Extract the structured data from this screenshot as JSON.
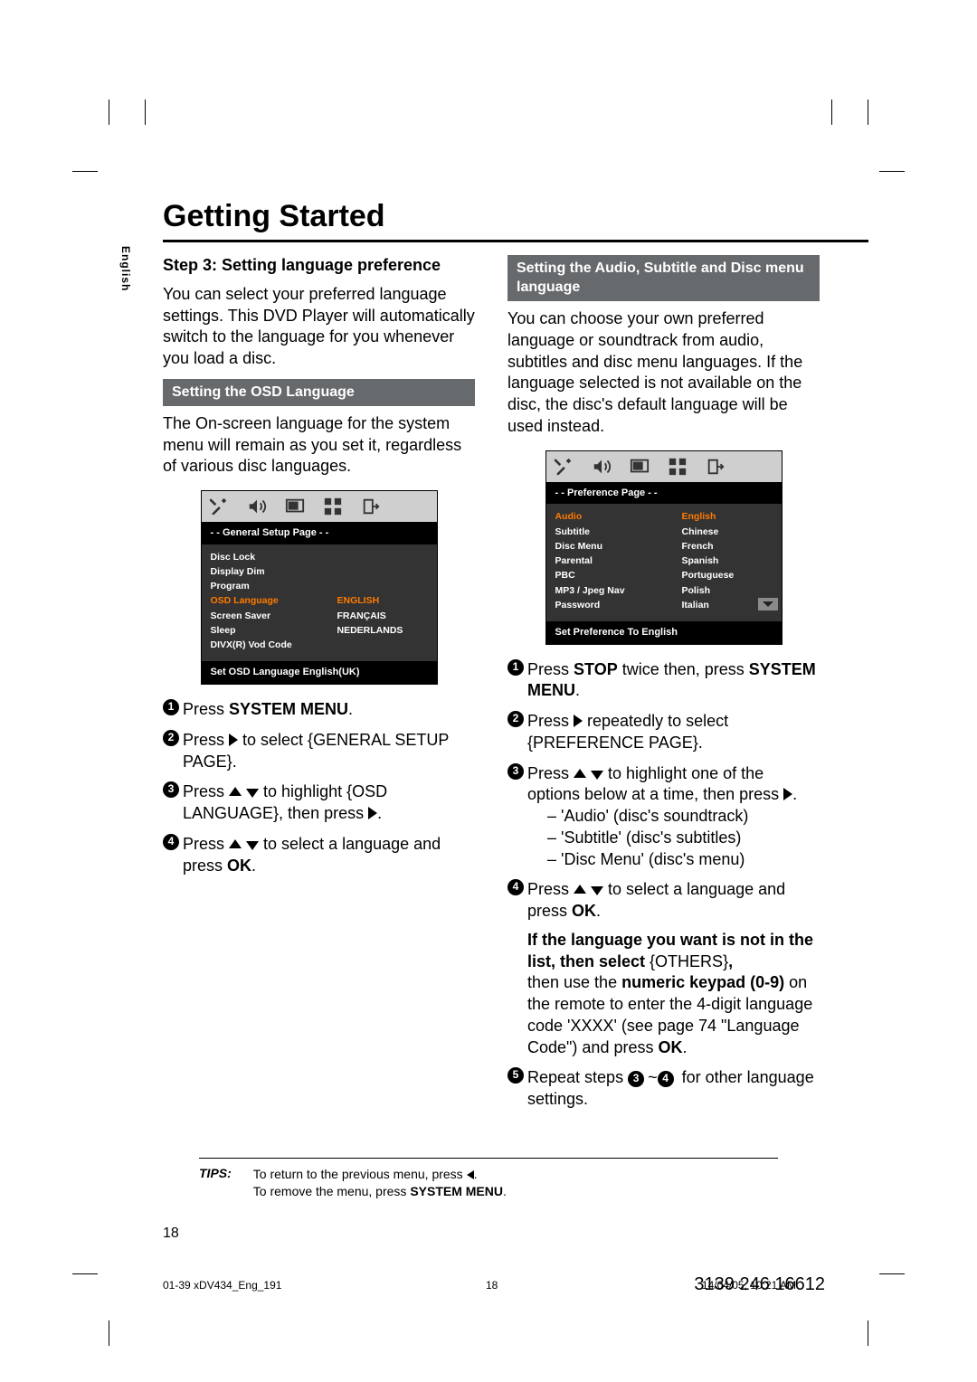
{
  "title": "Getting Started",
  "lang_tab": "English",
  "left": {
    "step_head": "Step 3:  Setting language preference",
    "intro": "You can select your preferred language settings. This DVD Player will automatically switch to the language for you whenever you load a disc.",
    "band1": "Setting the OSD Language",
    "para1": "The On-screen language for the system menu will remain as you set it, regardless of various disc languages.",
    "osd": {
      "page": "- -   General Setup Page   - -",
      "items": [
        "Disc Lock",
        "Display Dim",
        "Program",
        "OSD Language",
        "Screen Saver",
        "Sleep",
        "DIVX(R) Vod Code"
      ],
      "opts": [
        "ENGLISH",
        "FRANÇAIS",
        "NEDERLANDS"
      ],
      "hl_item": 3,
      "hl_opt": 0,
      "foot": "Set OSD Language English(UK)"
    },
    "s1a": "Press ",
    "s1b": "SYSTEM MENU",
    "s1c": ".",
    "s2a": "Press ",
    "s2b": " to select {GENERAL SETUP PAGE}.",
    "s3a": "Press ",
    "s3b": " to highlight {OSD LANGUAGE}, then press ",
    "s3c": ".",
    "s4a": "Press ",
    "s4b": "  to select a language and press ",
    "s4c": "OK",
    "s4d": "."
  },
  "right": {
    "band": "Setting the Audio, Subtitle and Disc menu language",
    "intro": "You can choose your own preferred language or soundtrack from audio, subtitles and disc menu languages. If the language selected is not available on the disc, the disc's default language will be used instead.",
    "osd": {
      "page": "- -   Preference Page   - -",
      "items": [
        "Audio",
        "Subtitle",
        "Disc Menu",
        "Parental",
        "PBC",
        "MP3 / Jpeg Nav",
        "Password"
      ],
      "opts": [
        "English",
        "Chinese",
        "French",
        "Spanish",
        "Portuguese",
        "Polish",
        "Italian"
      ],
      "hl_item": 0,
      "hl_opt": 0,
      "foot": "Set Preference To English"
    },
    "s1a": "Press ",
    "s1b": "STOP",
    "s1c": " twice then, press ",
    "s1d": "SYSTEM MENU",
    "s1e": ".",
    "s2a": "Press ",
    "s2b": " repeatedly to select {PREFERENCE PAGE}.",
    "s3a": "Press ",
    "s3b": "  to highlight one of the options below at a time, then press ",
    "s3c": ".",
    "s3d1": "–   'Audio' (disc's soundtrack)",
    "s3d2": "–   'Subtitle' (disc's subtitles)",
    "s3d3": "–   'Disc Menu' (disc's menu)",
    "s4a": "Press ",
    "s4b": "  to select a language and press ",
    "s4c": "OK",
    "s4d": ".",
    "s5a": "If the language you want is not in the list, then select ",
    "s5b": "{OTHERS}",
    "s5c": ",",
    "s5d": "then use the ",
    "s5e": "numeric keypad (0-9)",
    "s5f": " on the remote to enter the 4-digit language code 'XXXX' (see page 74 \"Language Code\") and press ",
    "s5g": "OK",
    "s5h": ".",
    "s6a": "Repeat steps ",
    "s6b": "~",
    "s6c": " for other language settings."
  },
  "tips": {
    "label": "TIPS:",
    "line1a": "To return to the previous menu, press ",
    "line1b": ".",
    "line2a": "To remove the menu, press ",
    "line2b": "SYSTEM MENU",
    "line2c": "."
  },
  "page_bottom_num": "18",
  "meta_left": "01-39 xDV434_Eng_191",
  "meta_mid": "18",
  "meta_right": "14/04/05, 10:21 AM",
  "serial": "3139 246 16612"
}
